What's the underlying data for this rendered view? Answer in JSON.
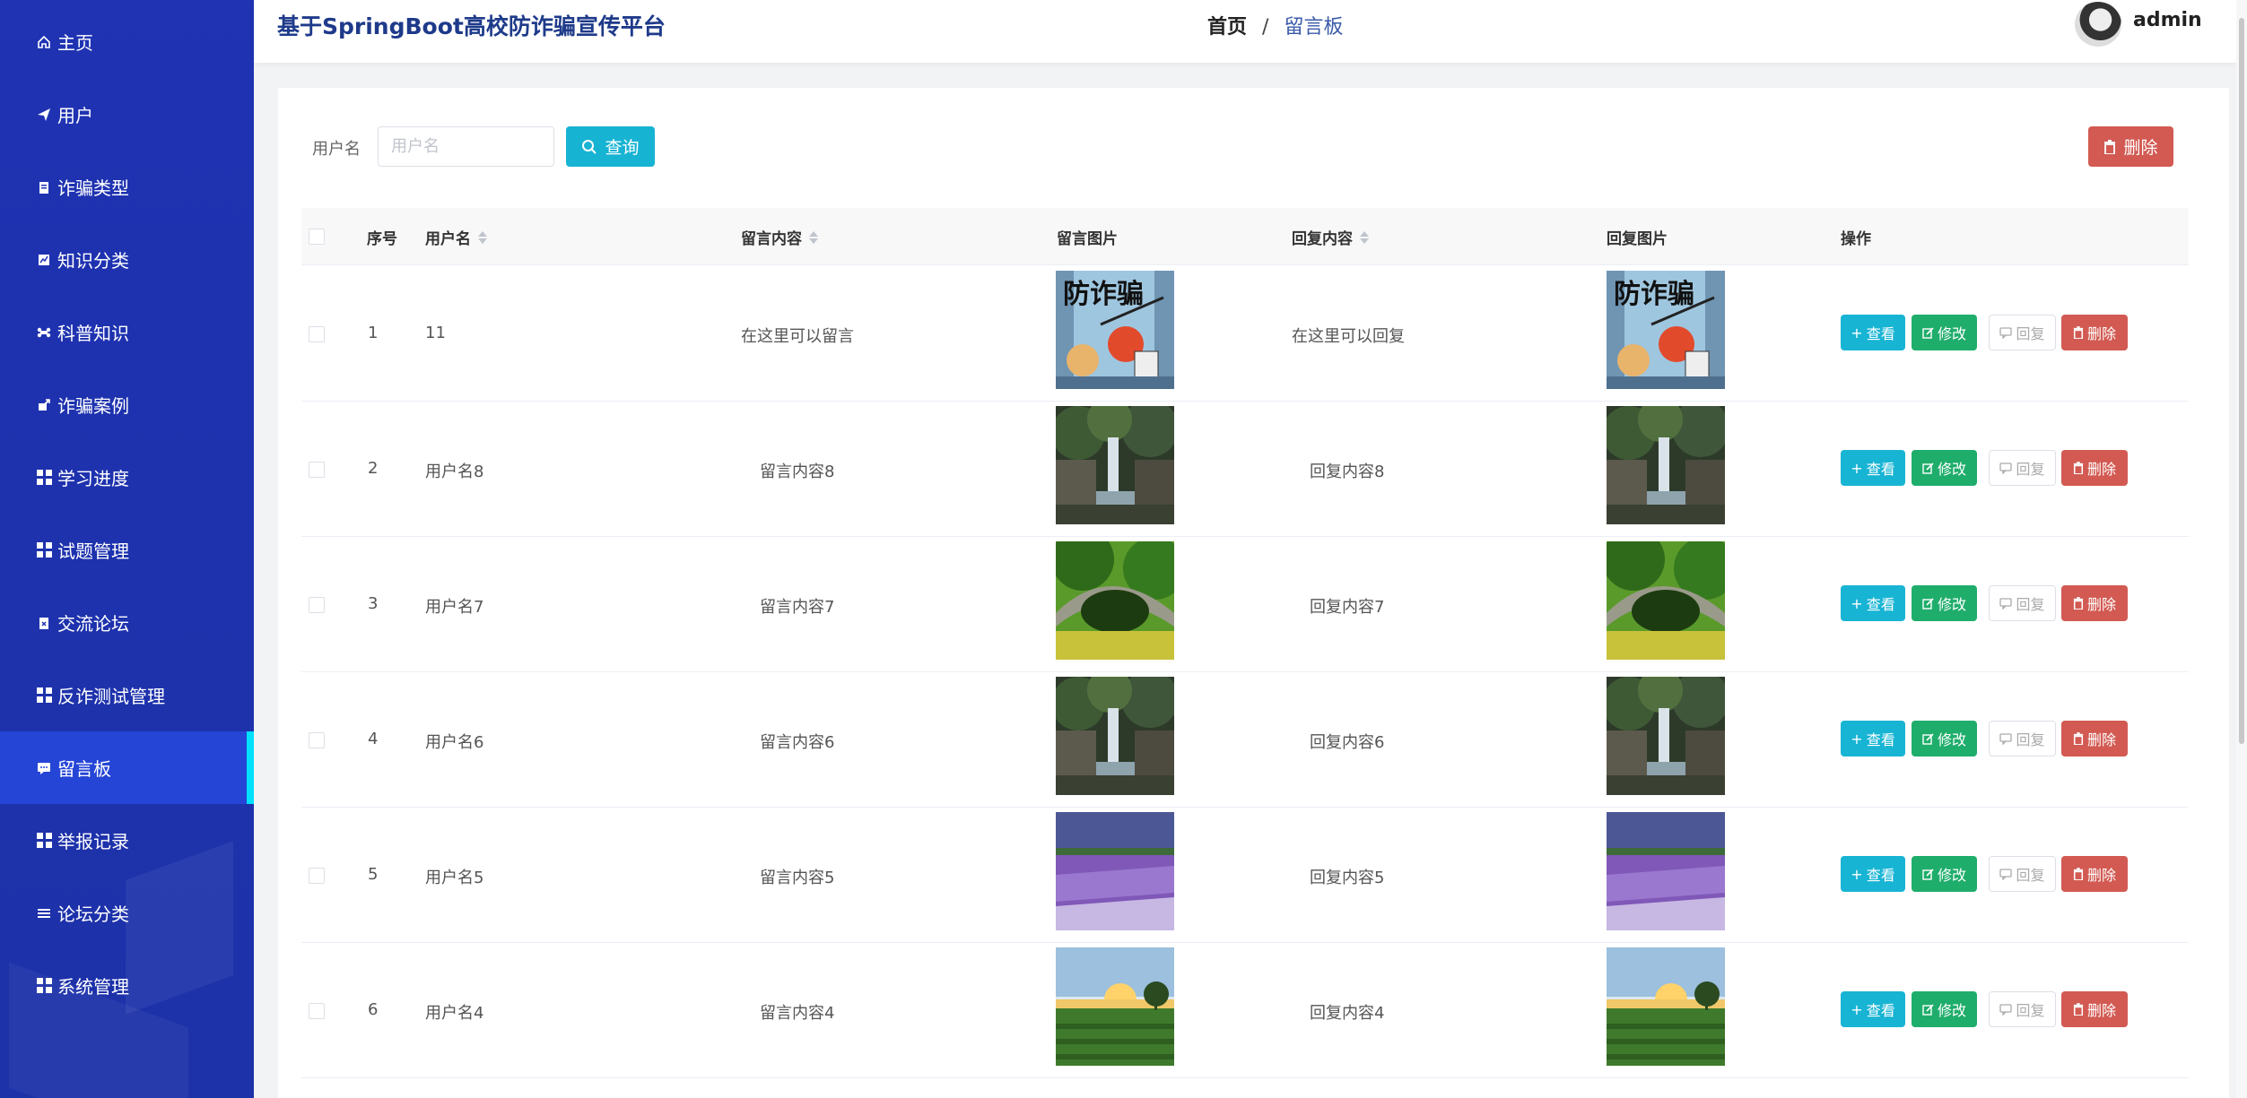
{
  "app": {
    "title": "基于SpringBoot高校防诈骗宣传平台"
  },
  "breadcrumb": {
    "home": "首页",
    "separator": "/",
    "current": "留言板"
  },
  "user": {
    "name": "admin"
  },
  "sidebar": {
    "items": [
      {
        "label": "主页",
        "icon": "home-icon"
      },
      {
        "label": "用户",
        "icon": "send-icon"
      },
      {
        "label": "诈骗类型",
        "icon": "clipboard-icon"
      },
      {
        "label": "知识分类",
        "icon": "chart-icon"
      },
      {
        "label": "科普知识",
        "icon": "bone-icon"
      },
      {
        "label": "诈骗案例",
        "icon": "share-icon"
      },
      {
        "label": "学习进度",
        "icon": "grid-icon"
      },
      {
        "label": "试题管理",
        "icon": "grid-icon"
      },
      {
        "label": "交流论坛",
        "icon": "clipboard-x-icon"
      },
      {
        "label": "反诈测试管理",
        "icon": "grid-icon"
      },
      {
        "label": "留言板",
        "icon": "comment-icon",
        "active": true
      },
      {
        "label": "举报记录",
        "icon": "grid-icon"
      },
      {
        "label": "论坛分类",
        "icon": "list-icon"
      },
      {
        "label": "系统管理",
        "icon": "grid-icon"
      }
    ]
  },
  "search": {
    "label": "用户名",
    "placeholder": "用户名",
    "query_label": "查询"
  },
  "toolbar": {
    "delete_label": "删除"
  },
  "table": {
    "columns": [
      "序号",
      "用户名",
      "留言内容",
      "留言图片",
      "回复内容",
      "回复图片",
      "操作"
    ],
    "rows": [
      {
        "index": "1",
        "username": "11",
        "content": "在这里可以留言",
        "image": "poster",
        "reply": "在这里可以回复",
        "reply_image": "poster"
      },
      {
        "index": "2",
        "username": "用户名8",
        "content": "留言内容8",
        "image": "waterfall",
        "reply": "回复内容8",
        "reply_image": "waterfall"
      },
      {
        "index": "3",
        "username": "用户名7",
        "content": "留言内容7",
        "image": "bridge",
        "reply": "回复内容7",
        "reply_image": "bridge"
      },
      {
        "index": "4",
        "username": "用户名6",
        "content": "留言内容6",
        "image": "waterfall",
        "reply": "回复内容6",
        "reply_image": "waterfall"
      },
      {
        "index": "5",
        "username": "用户名5",
        "content": "留言内容5",
        "image": "lavender",
        "reply": "回复内容5",
        "reply_image": "lavender"
      },
      {
        "index": "6",
        "username": "用户名4",
        "content": "留言内容4",
        "image": "tea-field",
        "reply": "回复内容4",
        "reply_image": "tea-field"
      }
    ],
    "actions": {
      "view": "查看",
      "edit": "修改",
      "reply": "回复",
      "delete": "删除"
    }
  },
  "colors": {
    "sidebar": "#1f33b3",
    "active": "#2545d6",
    "accent": "#00e1ff",
    "info": "#18b4d4",
    "success": "#1fad6b",
    "danger": "#d25a52"
  }
}
